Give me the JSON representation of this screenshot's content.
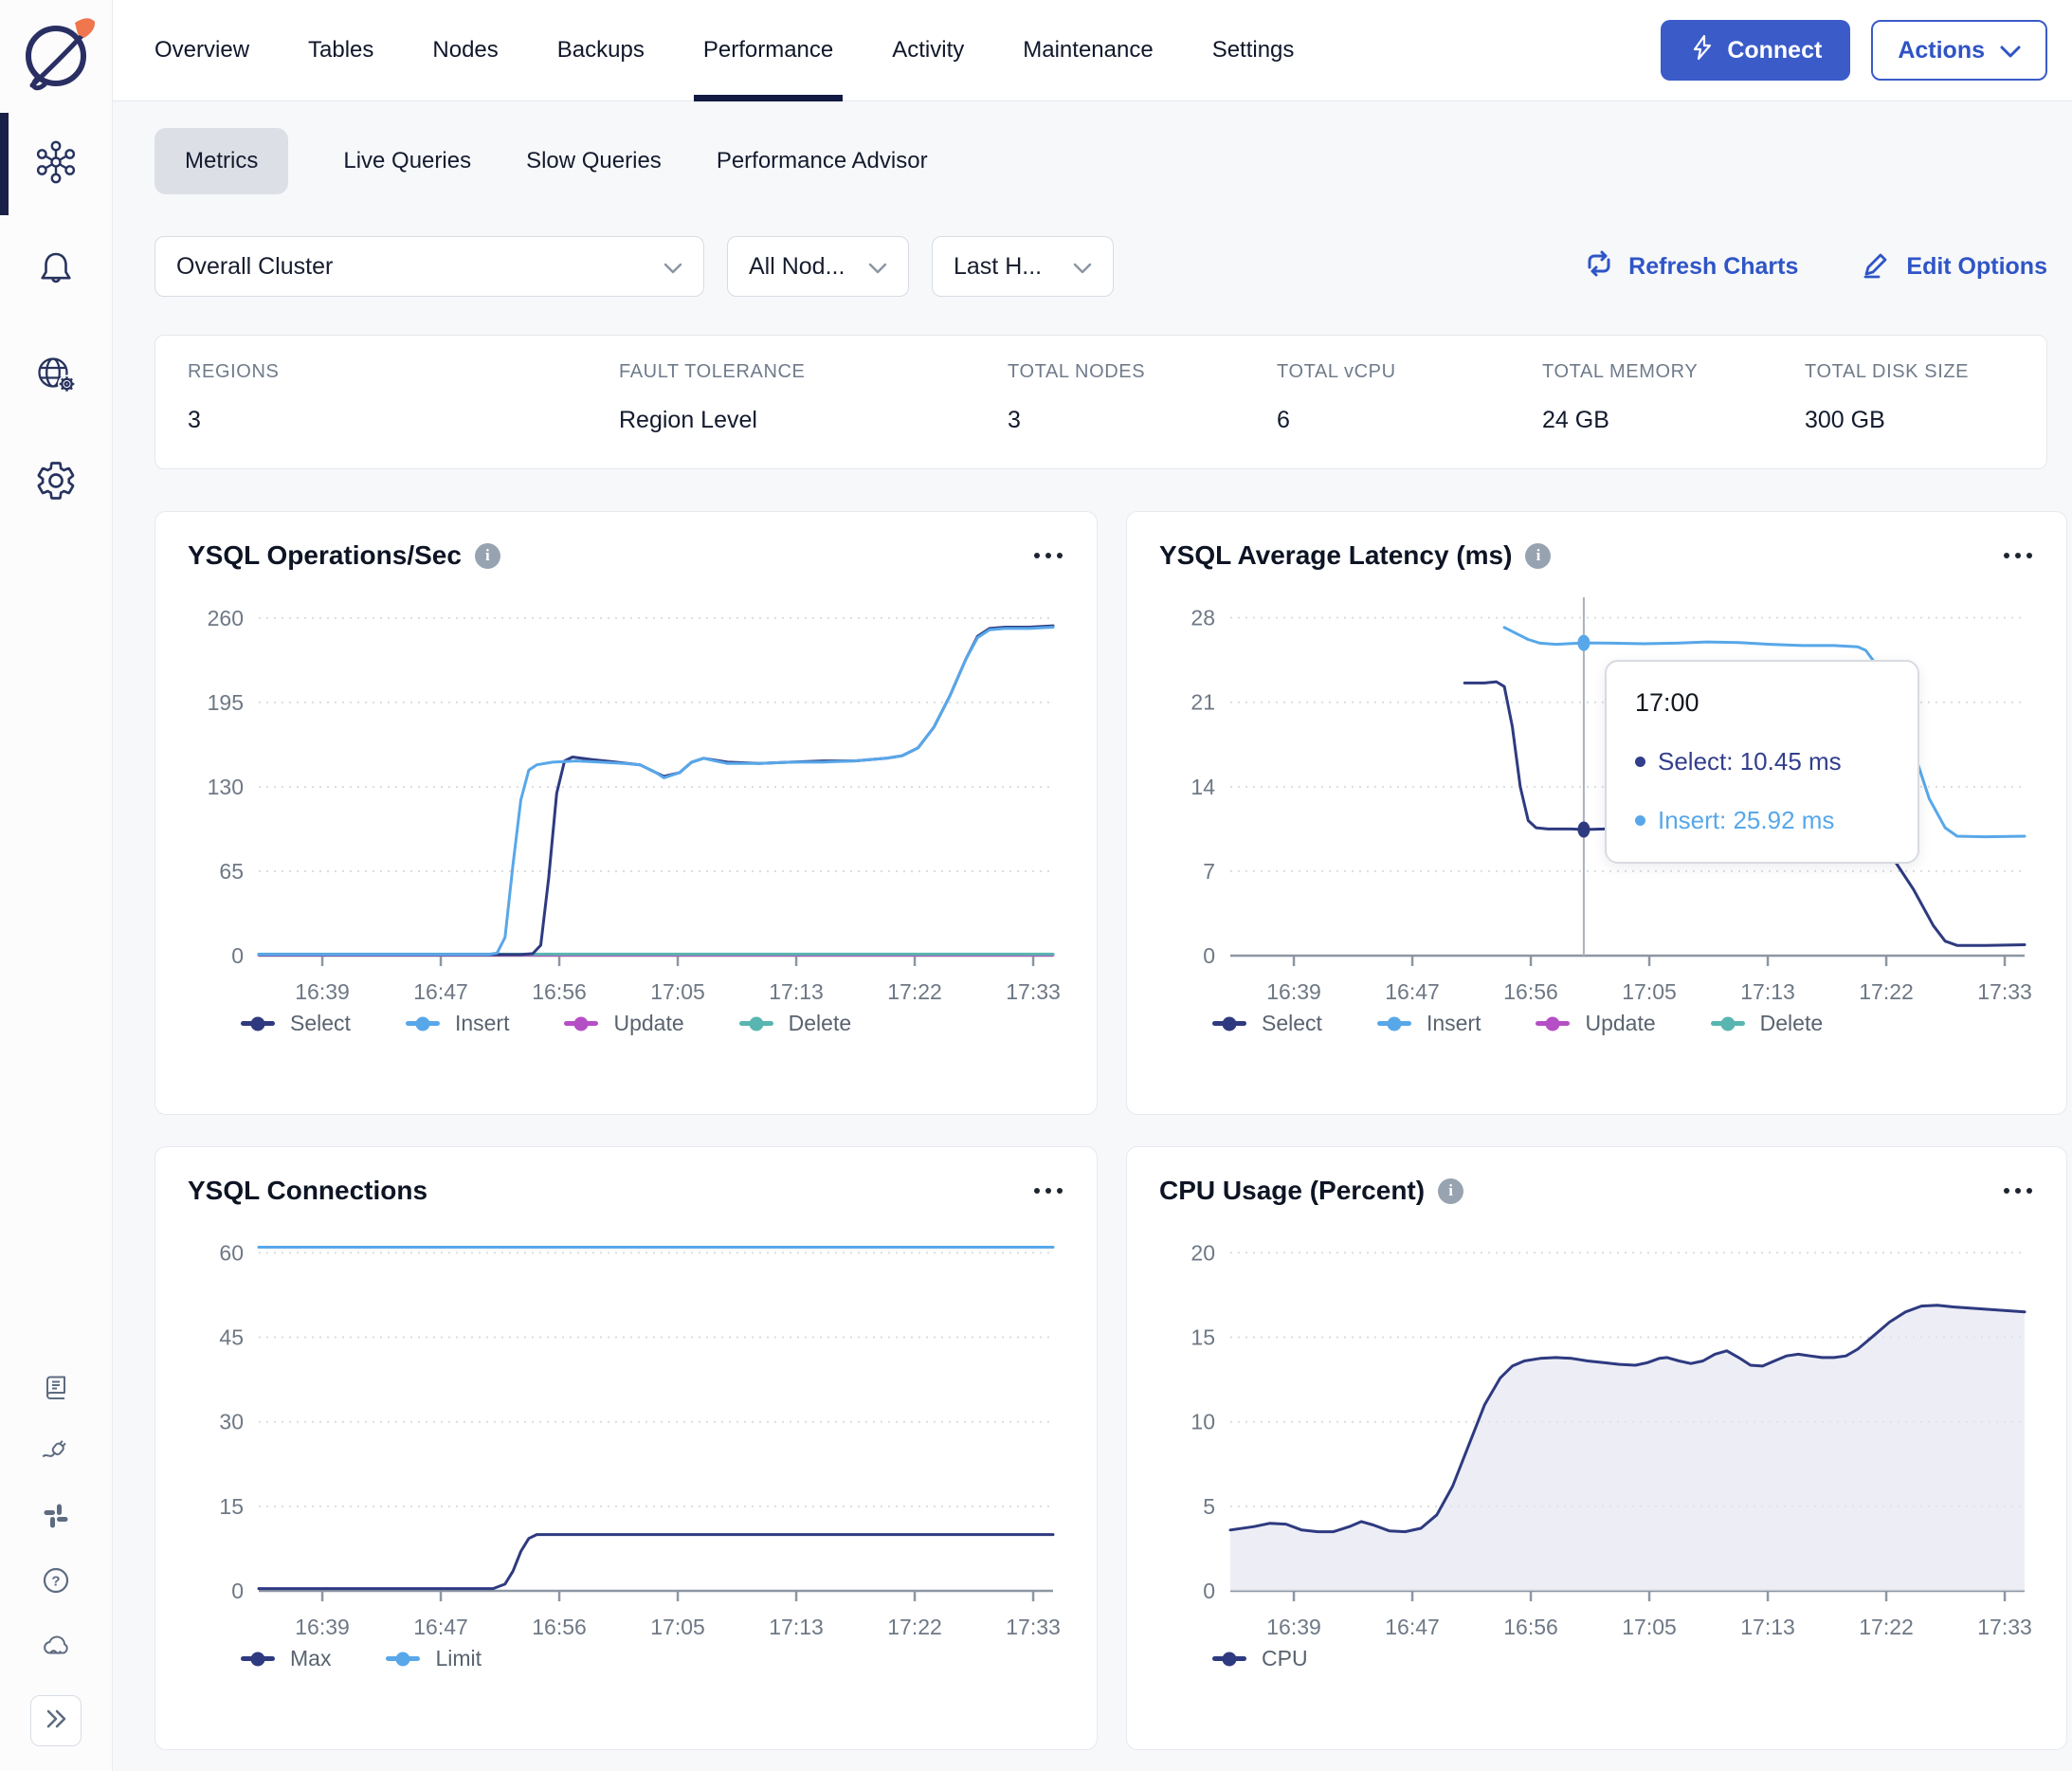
{
  "colors": {
    "accent_blue": "#3A5BC8",
    "link_blue": "#2F55C6",
    "navy_series": "#2E3A80",
    "light_blue_series": "#58A7E9",
    "magenta_series": "#B54FC5",
    "teal_series": "#58B5B0",
    "active_bar": "#1A2148",
    "card_border": "#E7E9ED"
  },
  "topnav": {
    "tabs": [
      {
        "label": "Overview",
        "active": false
      },
      {
        "label": "Tables",
        "active": false
      },
      {
        "label": "Nodes",
        "active": false
      },
      {
        "label": "Backups",
        "active": false
      },
      {
        "label": "Performance",
        "active": true
      },
      {
        "label": "Activity",
        "active": false
      },
      {
        "label": "Maintenance",
        "active": false
      },
      {
        "label": "Settings",
        "active": false
      }
    ],
    "connect_label": "Connect",
    "actions_label": "Actions"
  },
  "subtabs": [
    {
      "label": "Metrics",
      "active": true
    },
    {
      "label": "Live Queries",
      "active": false
    },
    {
      "label": "Slow Queries",
      "active": false
    },
    {
      "label": "Performance Advisor",
      "active": false
    }
  ],
  "filters": {
    "cluster": "Overall Cluster",
    "nodes": "All Nod...",
    "time_range": "Last H..."
  },
  "toolbar": {
    "refresh_label": "Refresh Charts",
    "edit_label": "Edit Options"
  },
  "stats": [
    {
      "label": "REGIONS",
      "value": "3"
    },
    {
      "label": "FAULT TOLERANCE",
      "value": "Region Level"
    },
    {
      "label": "TOTAL NODES",
      "value": "3"
    },
    {
      "label": "TOTAL vCPU",
      "value": "6"
    },
    {
      "label": "TOTAL MEMORY",
      "value": "24 GB"
    },
    {
      "label": "TOTAL DISK SIZE",
      "value": "300 GB"
    }
  ],
  "chart_data": [
    {
      "type": "line",
      "title": "YSQL Operations/Sec",
      "info_icon": true,
      "yticks": [
        0,
        65,
        130,
        195,
        260
      ],
      "ymax": 276,
      "x_labels": [
        "16:39",
        "16:47",
        "16:56",
        "17:05",
        "17:13",
        "17:22",
        "17:33"
      ],
      "legend": [
        {
          "label": "Select",
          "color": "#2E3A80"
        },
        {
          "label": "Insert",
          "color": "#58A7E9"
        },
        {
          "label": "Update",
          "color": "#B54FC5"
        },
        {
          "label": "Delete",
          "color": "#58B5B0"
        }
      ],
      "series": [
        {
          "name": "Update",
          "color": "#B54FC5",
          "points": [
            [
              0,
              0.5
            ],
            [
              1,
              0.5
            ]
          ]
        },
        {
          "name": "Delete",
          "color": "#58B5B0",
          "points": [
            [
              0,
              1.2
            ],
            [
              1,
              1.2
            ]
          ]
        },
        {
          "name": "Select",
          "color": "#2E3A80",
          "points": [
            [
              0,
              0.8
            ],
            [
              0.33,
              0.8
            ],
            [
              0.345,
              1.5
            ],
            [
              0.355,
              8
            ],
            [
              0.365,
              60
            ],
            [
              0.375,
              125
            ],
            [
              0.385,
              150
            ],
            [
              0.395,
              153
            ],
            [
              0.42,
              151
            ],
            [
              0.45,
              149
            ],
            [
              0.48,
              147
            ],
            [
              0.5,
              141
            ],
            [
              0.51,
              138
            ],
            [
              0.53,
              141
            ],
            [
              0.545,
              149
            ],
            [
              0.56,
              152
            ],
            [
              0.59,
              149
            ],
            [
              0.63,
              148
            ],
            [
              0.67,
              149
            ],
            [
              0.71,
              150
            ],
            [
              0.75,
              150
            ],
            [
              0.79,
              152
            ],
            [
              0.81,
              154
            ],
            [
              0.83,
              160
            ],
            [
              0.85,
              176
            ],
            [
              0.87,
              200
            ],
            [
              0.89,
              228
            ],
            [
              0.905,
              246
            ],
            [
              0.92,
              252
            ],
            [
              0.94,
              253
            ],
            [
              0.97,
              253
            ],
            [
              1,
              254
            ]
          ]
        },
        {
          "name": "Insert",
          "color": "#58A7E9",
          "points": [
            [
              0,
              1
            ],
            [
              0.29,
              1
            ],
            [
              0.3,
              2
            ],
            [
              0.31,
              14
            ],
            [
              0.32,
              70
            ],
            [
              0.33,
              120
            ],
            [
              0.34,
              143
            ],
            [
              0.35,
              147
            ],
            [
              0.37,
              149
            ],
            [
              0.4,
              150
            ],
            [
              0.43,
              149
            ],
            [
              0.46,
              148
            ],
            [
              0.48,
              147
            ],
            [
              0.5,
              141
            ],
            [
              0.51,
              137
            ],
            [
              0.53,
              141
            ],
            [
              0.545,
              149
            ],
            [
              0.56,
              152
            ],
            [
              0.575,
              150
            ],
            [
              0.59,
              148
            ],
            [
              0.63,
              148
            ],
            [
              0.67,
              149
            ],
            [
              0.71,
              149
            ],
            [
              0.75,
              150
            ],
            [
              0.79,
              152
            ],
            [
              0.81,
              154
            ],
            [
              0.83,
              160
            ],
            [
              0.85,
              176
            ],
            [
              0.87,
              200
            ],
            [
              0.89,
              228
            ],
            [
              0.905,
              245
            ],
            [
              0.92,
              251
            ],
            [
              0.94,
              252
            ],
            [
              0.97,
              252
            ],
            [
              1,
              253
            ]
          ]
        }
      ]
    },
    {
      "type": "line",
      "title": "YSQL Average Latency (ms)",
      "info_icon": true,
      "yticks": [
        0,
        7,
        14,
        21,
        28
      ],
      "ymax": 29.7,
      "x_labels": [
        "16:39",
        "16:47",
        "16:56",
        "17:05",
        "17:13",
        "17:22",
        "17:33"
      ],
      "legend": [
        {
          "label": "Select",
          "color": "#2E3A80"
        },
        {
          "label": "Insert",
          "color": "#58A7E9"
        },
        {
          "label": "Update",
          "color": "#B54FC5"
        },
        {
          "label": "Delete",
          "color": "#58B5B0"
        }
      ],
      "series": [
        {
          "name": "Select",
          "color": "#2E3A80",
          "points": [
            [
              0.295,
              22.6
            ],
            [
              0.32,
              22.6
            ],
            [
              0.335,
              22.7
            ],
            [
              0.345,
              22.3
            ],
            [
              0.355,
              19
            ],
            [
              0.365,
              14
            ],
            [
              0.375,
              11.2
            ],
            [
              0.385,
              10.6
            ],
            [
              0.4,
              10.5
            ],
            [
              0.43,
              10.5
            ],
            [
              0.445,
              10.45
            ],
            [
              0.47,
              10.5
            ],
            [
              0.49,
              10.6
            ],
            [
              0.5,
              10.5
            ],
            [
              0.52,
              10.5
            ],
            [
              0.54,
              10.7
            ],
            [
              0.555,
              10.9
            ],
            [
              0.57,
              10.7
            ],
            [
              0.6,
              10.6
            ],
            [
              0.64,
              10.6
            ],
            [
              0.68,
              10.6
            ],
            [
              0.72,
              10.6
            ],
            [
              0.76,
              10.5
            ],
            [
              0.79,
              10.5
            ],
            [
              0.81,
              10
            ],
            [
              0.83,
              8.5
            ],
            [
              0.86,
              5.5
            ],
            [
              0.885,
              2.5
            ],
            [
              0.9,
              1.2
            ],
            [
              0.915,
              0.85
            ],
            [
              0.95,
              0.85
            ],
            [
              1,
              0.9
            ]
          ]
        },
        {
          "name": "Insert",
          "color": "#58A7E9",
          "points": [
            [
              0.345,
              27.2
            ],
            [
              0.36,
              26.7
            ],
            [
              0.375,
              26.2
            ],
            [
              0.39,
              25.9
            ],
            [
              0.41,
              25.8
            ],
            [
              0.445,
              25.92
            ],
            [
              0.48,
              25.9
            ],
            [
              0.52,
              25.85
            ],
            [
              0.56,
              25.9
            ],
            [
              0.6,
              26.0
            ],
            [
              0.64,
              25.95
            ],
            [
              0.68,
              25.8
            ],
            [
              0.72,
              25.7
            ],
            [
              0.76,
              25.7
            ],
            [
              0.79,
              25.6
            ],
            [
              0.8,
              25.3
            ],
            [
              0.82,
              23.5
            ],
            [
              0.85,
              19
            ],
            [
              0.88,
              13
            ],
            [
              0.9,
              10.6
            ],
            [
              0.915,
              9.9
            ],
            [
              0.95,
              9.85
            ],
            [
              1,
              9.9
            ]
          ]
        }
      ],
      "crosshair": {
        "fx": 0.445,
        "dots": [
          {
            "value": 25.92,
            "color": "#58A7E9"
          },
          {
            "value": 10.45,
            "color": "#2E3A80"
          }
        ]
      },
      "tooltip": {
        "time": "17:00",
        "rows": [
          {
            "text": "Select: 10.45 ms",
            "color": "#323E8C"
          },
          {
            "text": "Insert: 25.92 ms",
            "color": "#58A7E9"
          }
        ],
        "left": 470,
        "top": 80
      }
    },
    {
      "type": "line",
      "title": "YSQL Connections",
      "info_icon": false,
      "yticks": [
        0,
        15,
        30,
        45,
        60
      ],
      "ymax": 63.6,
      "x_labels": [
        "16:39",
        "16:47",
        "16:56",
        "17:05",
        "17:13",
        "17:22",
        "17:33"
      ],
      "legend": [
        {
          "label": "Max",
          "color": "#2E3A80"
        },
        {
          "label": "Limit",
          "color": "#58A7E9"
        }
      ],
      "series": [
        {
          "name": "Limit",
          "color": "#58A7E9",
          "points": [
            [
              0,
              61
            ],
            [
              1,
              61
            ]
          ]
        },
        {
          "name": "Max",
          "color": "#2E3A80",
          "points": [
            [
              0,
              0.4
            ],
            [
              0.295,
              0.4
            ],
            [
              0.31,
              1.2
            ],
            [
              0.32,
              3.5
            ],
            [
              0.33,
              7
            ],
            [
              0.34,
              9.3
            ],
            [
              0.35,
              10
            ],
            [
              0.38,
              10
            ],
            [
              1,
              10
            ]
          ]
        }
      ]
    },
    {
      "type": "area",
      "title": "CPU Usage (Percent)",
      "info_icon": true,
      "yticks": [
        0,
        5,
        10,
        15,
        20
      ],
      "ymax": 21.2,
      "x_labels": [
        "16:39",
        "16:47",
        "16:56",
        "17:05",
        "17:13",
        "17:22",
        "17:33"
      ],
      "legend": [
        {
          "label": "CPU",
          "color": "#2E3A80"
        }
      ],
      "series": [
        {
          "name": "CPU",
          "color": "#2E3A80",
          "fill": "rgba(228,229,240,0.65)",
          "points": [
            [
              0,
              3.6
            ],
            [
              0.03,
              3.8
            ],
            [
              0.05,
              4.0
            ],
            [
              0.07,
              3.95
            ],
            [
              0.09,
              3.6
            ],
            [
              0.11,
              3.5
            ],
            [
              0.13,
              3.5
            ],
            [
              0.15,
              3.8
            ],
            [
              0.165,
              4.1
            ],
            [
              0.18,
              3.9
            ],
            [
              0.2,
              3.55
            ],
            [
              0.22,
              3.5
            ],
            [
              0.24,
              3.7
            ],
            [
              0.26,
              4.5
            ],
            [
              0.28,
              6.2
            ],
            [
              0.3,
              8.6
            ],
            [
              0.32,
              11
            ],
            [
              0.34,
              12.6
            ],
            [
              0.355,
              13.3
            ],
            [
              0.37,
              13.6
            ],
            [
              0.39,
              13.75
            ],
            [
              0.41,
              13.8
            ],
            [
              0.43,
              13.75
            ],
            [
              0.45,
              13.6
            ],
            [
              0.47,
              13.5
            ],
            [
              0.49,
              13.4
            ],
            [
              0.51,
              13.35
            ],
            [
              0.525,
              13.5
            ],
            [
              0.54,
              13.75
            ],
            [
              0.55,
              13.8
            ],
            [
              0.565,
              13.6
            ],
            [
              0.58,
              13.45
            ],
            [
              0.595,
              13.6
            ],
            [
              0.61,
              14.0
            ],
            [
              0.625,
              14.2
            ],
            [
              0.64,
              13.8
            ],
            [
              0.655,
              13.35
            ],
            [
              0.67,
              13.3
            ],
            [
              0.685,
              13.6
            ],
            [
              0.7,
              13.9
            ],
            [
              0.715,
              14.0
            ],
            [
              0.73,
              13.9
            ],
            [
              0.745,
              13.8
            ],
            [
              0.76,
              13.8
            ],
            [
              0.775,
              13.9
            ],
            [
              0.79,
              14.3
            ],
            [
              0.81,
              15.1
            ],
            [
              0.83,
              15.9
            ],
            [
              0.85,
              16.5
            ],
            [
              0.87,
              16.85
            ],
            [
              0.89,
              16.9
            ],
            [
              0.91,
              16.8
            ],
            [
              0.94,
              16.7
            ],
            [
              0.97,
              16.6
            ],
            [
              1,
              16.5
            ]
          ]
        }
      ]
    }
  ]
}
